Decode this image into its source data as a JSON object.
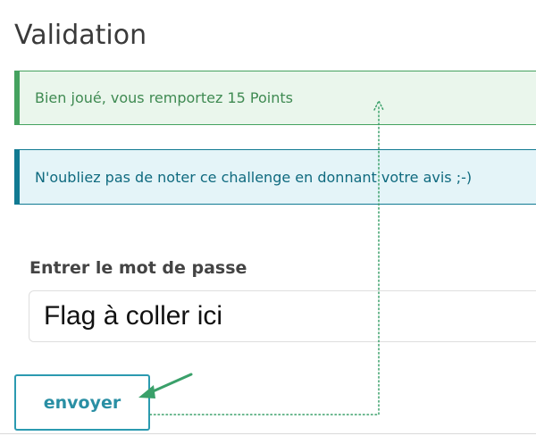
{
  "page": {
    "title": "Validation"
  },
  "alerts": {
    "success": "Bien joué, vous remportez 15 Points",
    "info": "N'oubliez pas de noter ce challenge en donnant votre avis ;-)"
  },
  "form": {
    "label": "Entrer le mot de passe",
    "placeholder": "Flag à coller ici",
    "submit_label": "envoyer"
  },
  "colors": {
    "success_border": "#45a25f",
    "info_border": "#117a92",
    "button_accent": "#2b9ab0",
    "annotation_arrow": "#3aa06a"
  },
  "icons": {
    "annotation_arrow": "arrow-pointer-icon",
    "dotted_connector": "dotted-connector-arrow-icon"
  }
}
